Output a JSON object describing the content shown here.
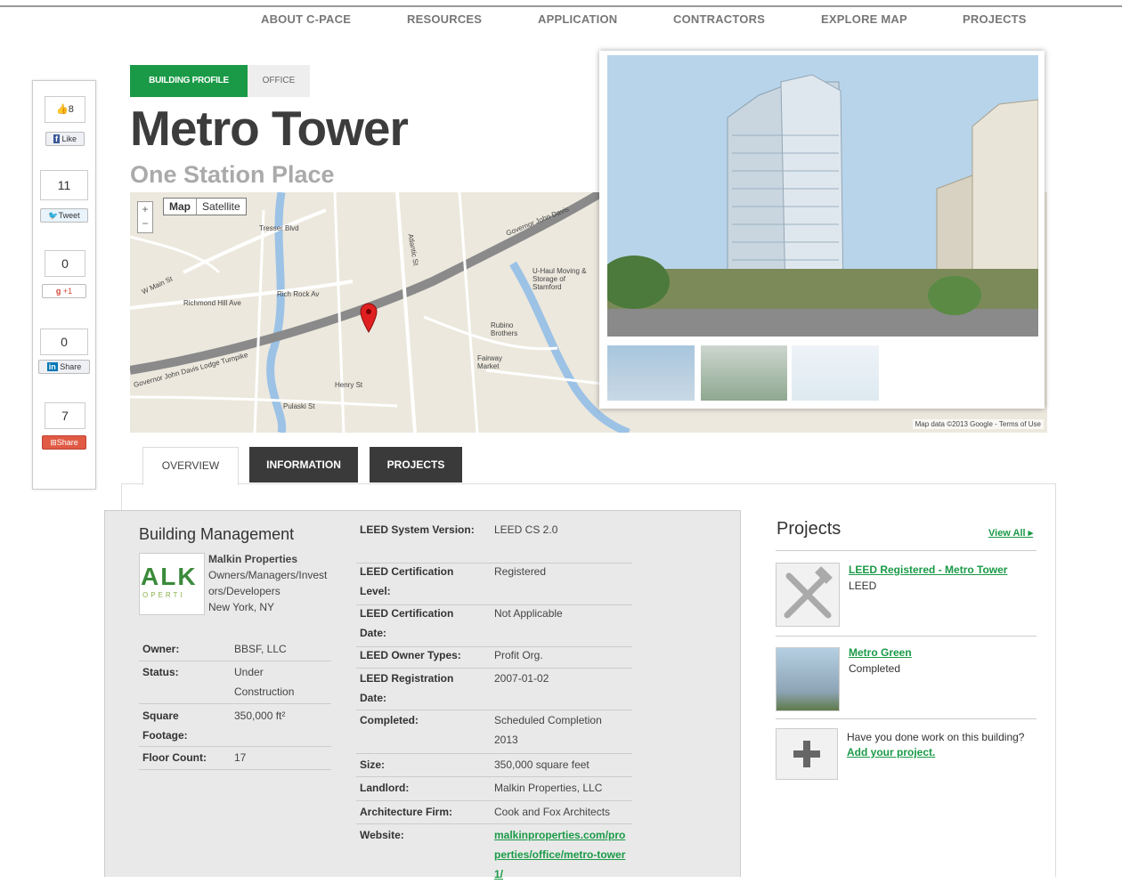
{
  "nav": [
    "ABOUT C-PACE",
    "RESOURCES",
    "APPLICATION",
    "CONTRACTORS",
    "EXPLORE MAP",
    "PROJECTS"
  ],
  "social": {
    "fb_count": "8",
    "fb_label": "Like",
    "tw_count": "11",
    "tw_label": "Tweet",
    "gp_count": "0",
    "gp_label": "+1",
    "li_count": "0",
    "li_label": "Share",
    "sh_count": "7",
    "sh_label": "Share"
  },
  "header": {
    "tab_profile": "BUILDING PROFILE",
    "tab_type": "OFFICE",
    "title": "Metro Tower",
    "subtitle": "One Station Place"
  },
  "map": {
    "type_map": "Map",
    "type_satellite": "Satellite",
    "zoom_in": "+",
    "zoom_out": "−",
    "footer": "Map data ©2013 Google - Terms of Use",
    "labels": [
      "Tresser Blvd",
      "W Main St",
      "Richmond Hill Ave",
      "Rich Rock Av",
      "Governor John Davis Lodge Turnpike",
      "Pulaski St",
      "Atlantic St",
      "U-Haul Moving & Storage of Stamford",
      "Rubino Brothers",
      "Fairway Market",
      "Henry St",
      "Governor John Davis"
    ]
  },
  "section_tabs": [
    "OVERVIEW",
    "INFORMATION",
    "PROJECTS"
  ],
  "management": {
    "title": "Building Management",
    "logo_text": "ALK",
    "logo_sub": "OPERTI",
    "company": "Malkin Properties",
    "role": "Owners/Managers/Investors/Developers",
    "location": "New York, NY",
    "details": [
      {
        "label": "Owner:",
        "value": "BBSF, LLC"
      },
      {
        "label": "Status:",
        "value": "Under Construction"
      },
      {
        "label": "Square Footage:",
        "value": "350,000 ft²"
      },
      {
        "label": "Floor Count:",
        "value": "17"
      }
    ]
  },
  "info": [
    {
      "label": "LEED System Version:",
      "value": "LEED CS 2.0"
    },
    {
      "label": "LEED Certification Level:",
      "value": "Registered"
    },
    {
      "label": "LEED Certification Date:",
      "value": "Not Applicable"
    },
    {
      "label": "LEED Owner Types:",
      "value": "Profit Org."
    },
    {
      "label": "LEED Registration Date:",
      "value": "2007-01-02"
    },
    {
      "label": "Completed:",
      "value": "Scheduled Completion 2013"
    },
    {
      "label": "Size:",
      "value": "350,000 square feet"
    },
    {
      "label": "Landlord:",
      "value": "Malkin Properties, LLC"
    },
    {
      "label": "Architecture Firm:",
      "value": "Cook and Fox Architects"
    },
    {
      "label": "Website:",
      "value": "malkinproperties.com/properties/office/metro-tower1/"
    }
  ],
  "projects": {
    "title": "Projects",
    "view_all": "View All ▸",
    "items": [
      {
        "name": "LEED Registered - Metro Tower",
        "sub": "LEED"
      },
      {
        "name": "Metro Green",
        "sub": "Completed"
      }
    ],
    "add_question": "Have you done work on this building?",
    "add_link": "Add your project."
  },
  "colors": {
    "green": "#1a9a47",
    "dark_tab": "#3a3a3a"
  }
}
